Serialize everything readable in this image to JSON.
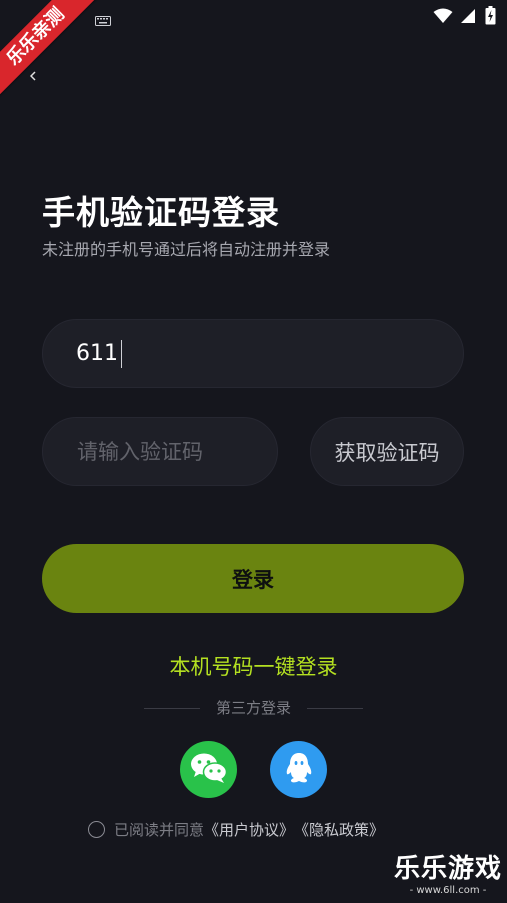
{
  "status_bar": {
    "icons": [
      "wifi-icon",
      "cellular-signal-icon",
      "battery-charging-icon",
      "keyboard-icon"
    ]
  },
  "ribbon": {
    "label": "乐乐亲测"
  },
  "header": {
    "title": "手机验证码登录",
    "subtitle": "未注册的手机号通过后将自动注册并登录"
  },
  "form": {
    "phone_value": "611",
    "code_placeholder": "请输入验证码",
    "get_code_label": "获取验证码",
    "login_label": "登录"
  },
  "one_key_login_label": "本机号码一键登录",
  "third_party": {
    "divider_label": "第三方登录",
    "providers": [
      "wechat-icon",
      "qq-icon"
    ]
  },
  "agreement": {
    "prefix": "已阅读并同意",
    "user_agreement": "《用户协议》",
    "privacy_policy": "《隐私政策》"
  },
  "watermark": {
    "title": "乐乐游戏",
    "url": "- www.6ll.com -"
  },
  "colors": {
    "background": "#15161d",
    "field": "#1e1f27",
    "login_button": "#6a8410",
    "link_green": "#b4e021",
    "wechat": "#29c24a",
    "qq": "#2f9bf0",
    "ribbon": "#d9262c"
  }
}
